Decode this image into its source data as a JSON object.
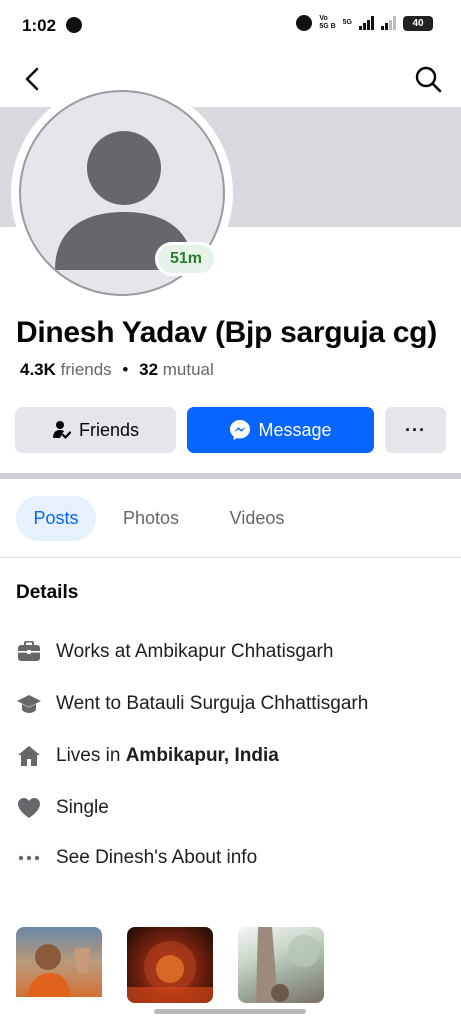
{
  "status_bar": {
    "time": "1:02",
    "network_label_top": "Vo",
    "network_label_bottom": "5G B",
    "network_5g": "5G",
    "battery": "40"
  },
  "profile": {
    "name": "Dinesh Yadav (Bjp sarguja cg)",
    "friends_count": "4.3K",
    "friends_label": "friends",
    "separator": "•",
    "mutual_count": "32",
    "mutual_label": "mutual",
    "active_badge": "51m"
  },
  "actions": {
    "friends_label": "Friends",
    "message_label": "Message",
    "more_label": "···",
    "message_color": "#0866ff"
  },
  "tabs": [
    {
      "label": "Posts",
      "active": true
    },
    {
      "label": "Photos",
      "active": false
    },
    {
      "label": "Videos",
      "active": false
    }
  ],
  "details": {
    "heading": "Details",
    "items": [
      {
        "icon": "briefcase-icon",
        "text": "Works at Ambikapur Chhatisgarh"
      },
      {
        "icon": "graduation-cap-icon",
        "text": "Went to Batauli Surguja Chhattisgarh"
      },
      {
        "icon": "home-icon",
        "prefix": "Lives in ",
        "bold": "Ambikapur, India"
      },
      {
        "icon": "heart-icon",
        "text": "Single"
      },
      {
        "icon": "more-dots-icon",
        "text": "See Dinesh's About info"
      }
    ]
  }
}
